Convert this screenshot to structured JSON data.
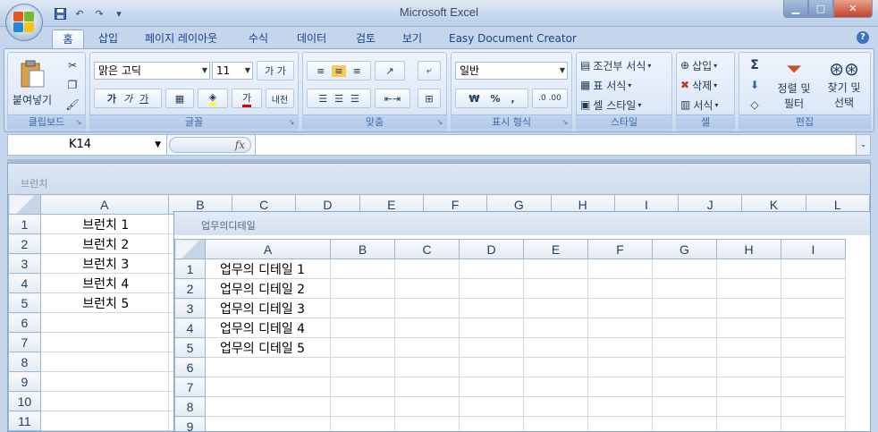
{
  "window": {
    "title": "Microsoft Excel"
  },
  "qat": {
    "save_icon": "save-icon",
    "undo_icon": "undo-icon",
    "redo_icon": "redo-icon",
    "customize_icon": "chevron-down-icon"
  },
  "tabs": [
    {
      "label": "홈",
      "active": true
    },
    {
      "label": "삽입"
    },
    {
      "label": "페이지 레이아웃"
    },
    {
      "label": "수식"
    },
    {
      "label": "데이터"
    },
    {
      "label": "검토"
    },
    {
      "label": "보기"
    },
    {
      "label": "Easy Document Creator"
    }
  ],
  "ribbon": {
    "clipboard": {
      "label": "클립보드",
      "paste": "붙여넣기"
    },
    "font": {
      "label": "글꼴",
      "font_name": "맑은 고딕",
      "font_size": "11",
      "bold": "가",
      "italic": "가",
      "underline": "가",
      "phonetic": "내천"
    },
    "alignment": {
      "label": "맞춤"
    },
    "number": {
      "label": "표시 형식",
      "format": "일반",
      "currency": "₩",
      "percent": "%",
      "comma": ","
    },
    "styles": {
      "label": "스타일",
      "conditional": "조건부 서식",
      "table": "표 서식",
      "cell_style": "셀 스타일"
    },
    "cells": {
      "label": "셀",
      "insert": "삽입",
      "delete": "삭제",
      "format": "서식"
    },
    "editing": {
      "label": "편집",
      "sum": "Σ",
      "sort_line1": "정렬 및",
      "sort_line2": "필터",
      "find_line1": "찾기 및",
      "find_line2": "선택"
    }
  },
  "formula_bar": {
    "name_box": "K14",
    "fx": "fx",
    "value": ""
  },
  "workbook1": {
    "title": "브런치",
    "columns": [
      "A",
      "B",
      "C",
      "D",
      "E",
      "F",
      "G",
      "H",
      "I",
      "J",
      "K",
      "L"
    ],
    "rows": [
      "1",
      "2",
      "3",
      "4",
      "5",
      "6",
      "7",
      "8",
      "9",
      "10",
      "11"
    ],
    "cells": [
      "브런치 1",
      "브런치 2",
      "브런치 3",
      "브런치 4",
      "브런치 5",
      "",
      "",
      "",
      "",
      "",
      ""
    ]
  },
  "workbook2": {
    "title": "업무의디테일",
    "columns": [
      "A",
      "B",
      "C",
      "D",
      "E",
      "F",
      "G",
      "H",
      "I"
    ],
    "rows": [
      "1",
      "2",
      "3",
      "4",
      "5",
      "6",
      "7",
      "8",
      "9"
    ],
    "cells": [
      "업무의 디테일 1",
      "업무의 디테일 2",
      "업무의 디테일 3",
      "업무의 디테일 4",
      "업무의 디테일 5",
      "",
      "",
      "",
      ""
    ]
  }
}
